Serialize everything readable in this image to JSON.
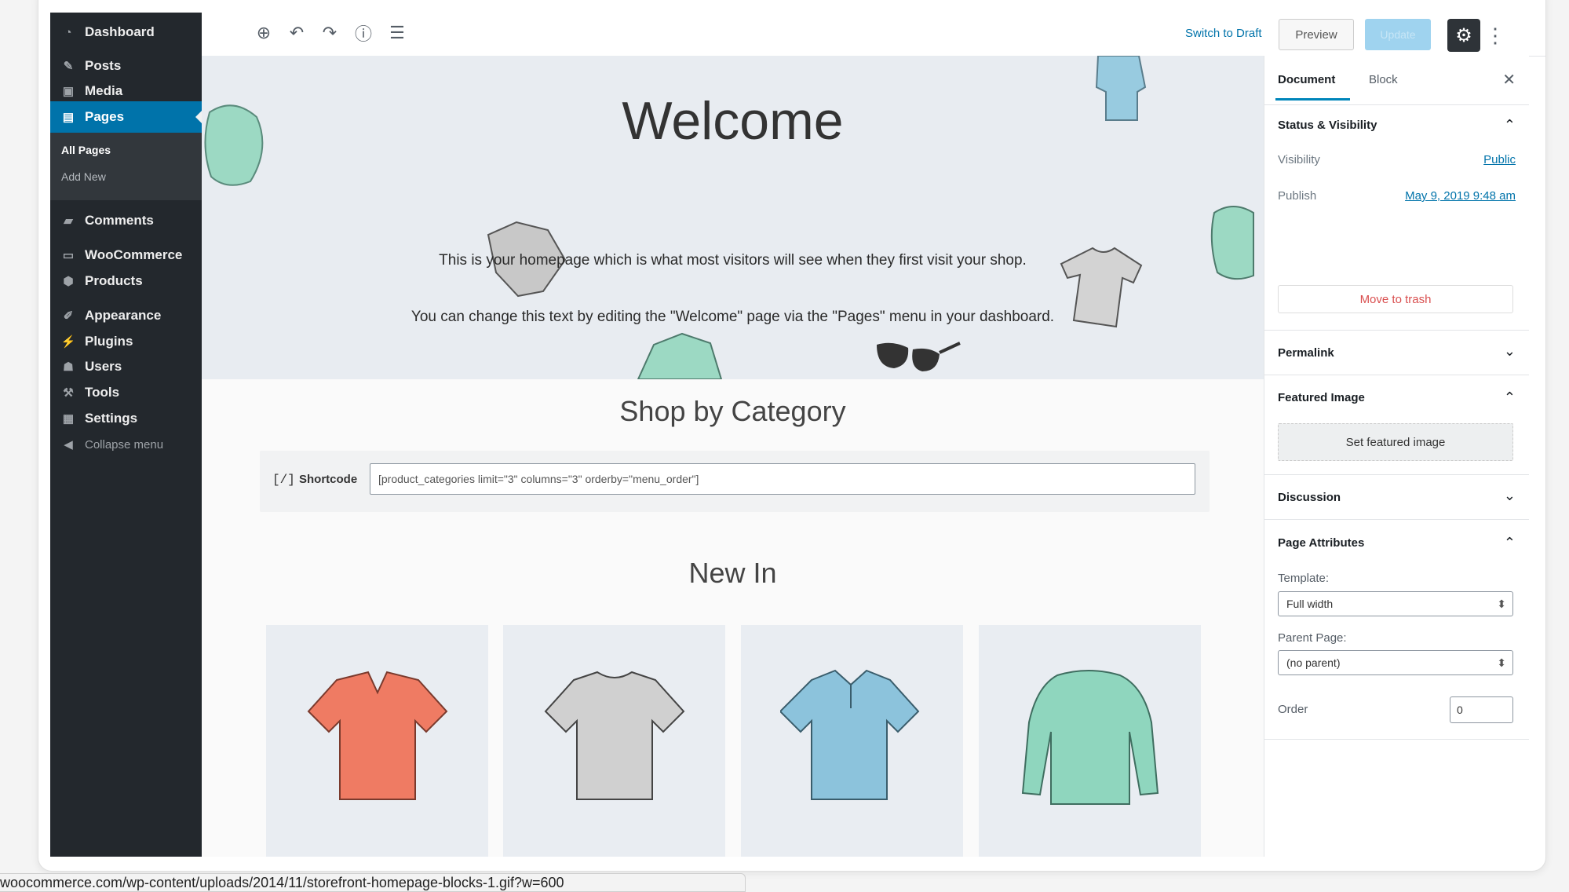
{
  "sidebar": {
    "items": [
      {
        "label": "Dashboard",
        "icon": "dashboard-icon"
      },
      {
        "label": "Posts",
        "icon": "pin-icon"
      },
      {
        "label": "Media",
        "icon": "media-icon"
      },
      {
        "label": "Pages",
        "icon": "pages-icon"
      },
      {
        "label": "Comments",
        "icon": "comment-icon"
      },
      {
        "label": "WooCommerce",
        "icon": "woocommerce-icon"
      },
      {
        "label": "Products",
        "icon": "box-icon"
      },
      {
        "label": "Appearance",
        "icon": "brush-icon"
      },
      {
        "label": "Plugins",
        "icon": "plug-icon"
      },
      {
        "label": "Users",
        "icon": "user-icon"
      },
      {
        "label": "Tools",
        "icon": "wrench-icon"
      },
      {
        "label": "Settings",
        "icon": "settings-icon"
      }
    ],
    "submenu": {
      "all_pages": "All Pages",
      "add_new": "Add New"
    },
    "collapse_label": "Collapse menu",
    "active": "Pages"
  },
  "toolbar": {
    "switch_to_draft": "Switch to Draft",
    "preview": "Preview",
    "update": "Update"
  },
  "content": {
    "title": "Welcome",
    "line1": "This is your homepage which is what most visitors will see when they first visit your shop.",
    "line2": "You can change this text by editing the \"Welcome\" page via the \"Pages\" menu in your dashboard.",
    "shop_title": "Shop by Category",
    "shortcode_icon": "[/]",
    "shortcode_label": "Shortcode",
    "shortcode_value": "[product_categories limit=\"3\" columns=\"3\" orderby=\"menu_order\"]",
    "new_in_title": "New In",
    "products": [
      {
        "color": "#ef7b63"
      },
      {
        "color": "#d0d0d0"
      },
      {
        "color": "#8cc3dc"
      },
      {
        "color": "#8fd6be"
      }
    ]
  },
  "settings": {
    "tab_document": "Document",
    "tab_block": "Block",
    "status_title": "Status & Visibility",
    "visibility_label": "Visibility",
    "visibility_value": "Public",
    "publish_label": "Publish",
    "publish_value": "May 9, 2019 9:48 am",
    "trash_label": "Move to trash",
    "permalink_title": "Permalink",
    "featured_title": "Featured Image",
    "featured_button": "Set featured image",
    "discussion_title": "Discussion",
    "attributes_title": "Page Attributes",
    "template_label": "Template:",
    "template_value": "Full width",
    "parent_label": "Parent Page:",
    "parent_value": "(no parent)",
    "order_label": "Order",
    "order_value": "0"
  },
  "statusbar": {
    "url": "woocommerce.com/wp-content/uploads/2014/11/storefront-homepage-blocks-1.gif?w=600"
  },
  "colors": {
    "admin_bar": "#23282d",
    "accent": "#0073aa",
    "trash": "#d94f4f"
  }
}
